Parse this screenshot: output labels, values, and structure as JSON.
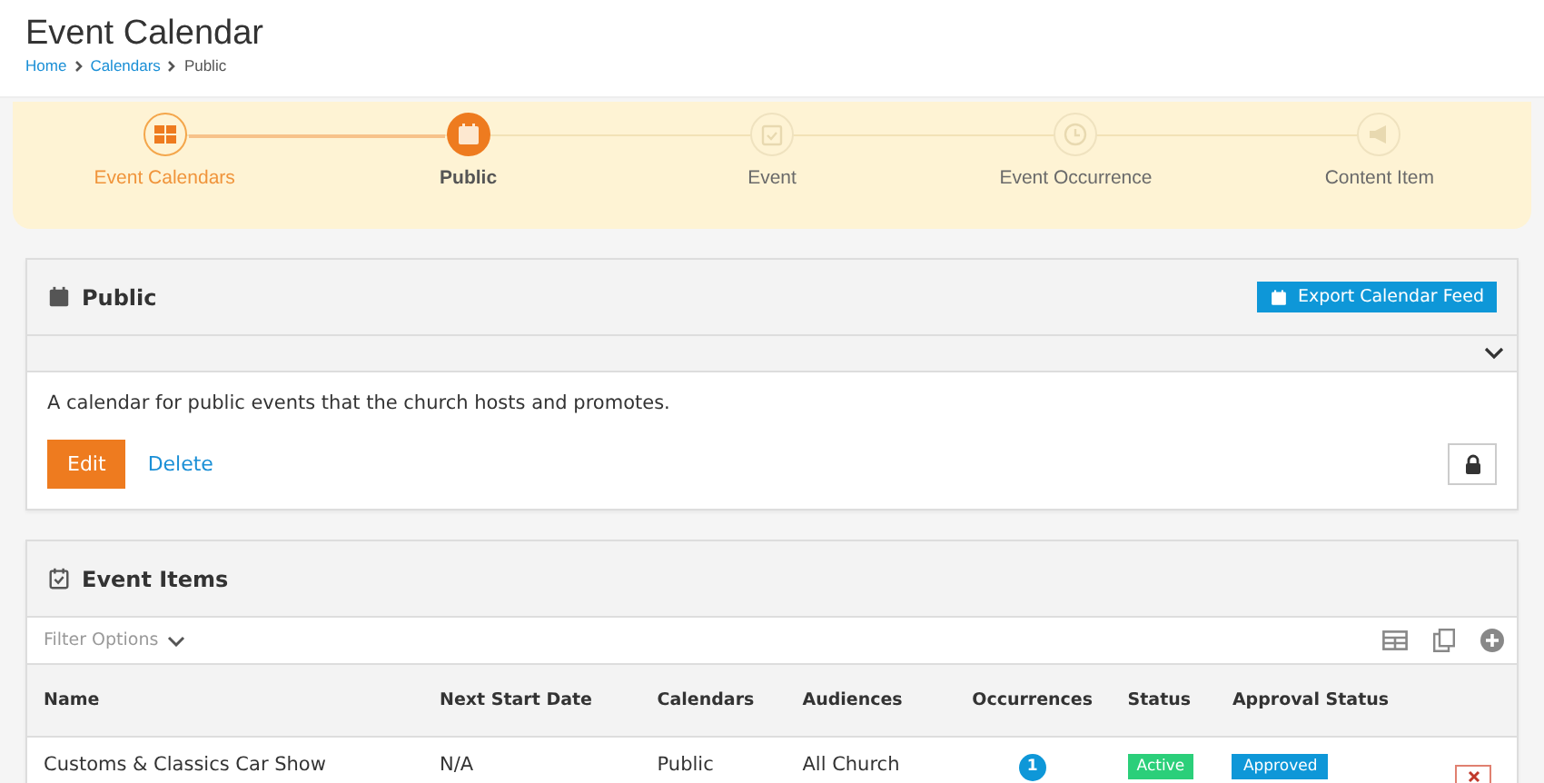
{
  "header": {
    "title": "Event Calendar",
    "breadcrumbs": [
      "Home",
      "Calendars",
      "Public"
    ]
  },
  "steps": [
    {
      "label": "Event Calendars",
      "kind": "done"
    },
    {
      "label": "Public",
      "kind": "current"
    },
    {
      "label": "Event",
      "kind": "pending"
    },
    {
      "label": "Event Occurrence",
      "kind": "pending"
    },
    {
      "label": "Content Item",
      "kind": "pending"
    }
  ],
  "calendar_panel": {
    "title": "Public",
    "export_button": "Export Calendar Feed",
    "description": "A calendar for public events that the church hosts and promotes.",
    "edit_button": "Edit",
    "delete_link": "Delete"
  },
  "items_panel": {
    "title": "Event Items",
    "filter_label": "Filter Options",
    "columns": [
      "Name",
      "Next Start Date",
      "Calendars",
      "Audiences",
      "Occurrences",
      "Status",
      "Approval Status"
    ],
    "rows": [
      {
        "name": "Customs & Classics Car Show",
        "next_start_date": "N/A",
        "calendars": "Public",
        "audiences": "All Church",
        "occurrences": "1",
        "status": "Active",
        "approval_status": "Approved"
      }
    ]
  }
}
